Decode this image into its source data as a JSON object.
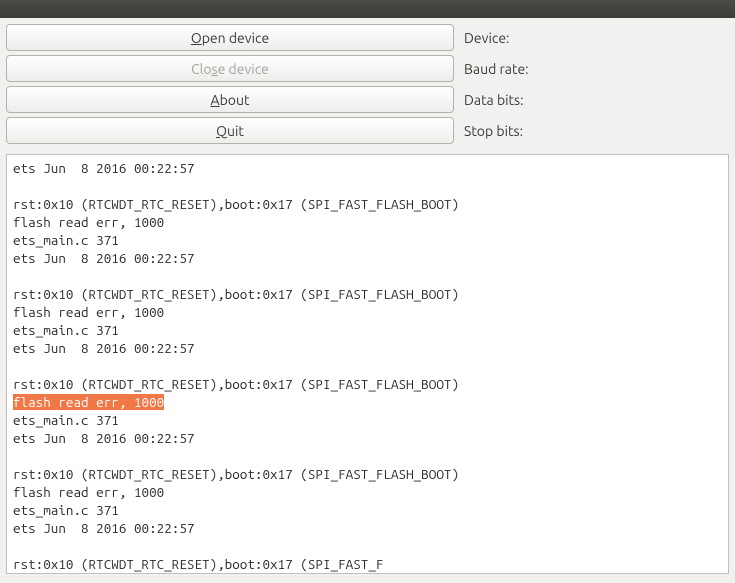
{
  "titlebar": {},
  "buttons": {
    "open_pre": "",
    "open_m": "O",
    "open_post": "pen device",
    "close_pre": "Clo",
    "close_m": "s",
    "close_post": "e device",
    "about_pre": "",
    "about_m": "A",
    "about_post": "bout",
    "quit_pre": "",
    "quit_m": "Q",
    "quit_post": "uit"
  },
  "labels": {
    "device": "Device:",
    "baud": "Baud rate:",
    "databits": "Data bits:",
    "stopbits": "Stop bits:"
  },
  "terminal": {
    "l0": "ets Jun  8 2016 00:22:57",
    "l1": "",
    "l2": "rst:0x10 (RTCWDT_RTC_RESET),boot:0x17 (SPI_FAST_FLASH_BOOT)",
    "l3": "flash read err, 1000",
    "l4": "ets_main.c 371 ",
    "l5": "ets Jun  8 2016 00:22:57",
    "l6": "",
    "l7": "rst:0x10 (RTCWDT_RTC_RESET),boot:0x17 (SPI_FAST_FLASH_BOOT)",
    "l8": "flash read err, 1000",
    "l9": "ets_main.c 371 ",
    "l10": "ets Jun  8 2016 00:22:57",
    "l11": "",
    "l12": "rst:0x10 (RTCWDT_RTC_RESET),boot:0x17 (SPI_FAST_FLASH_BOOT)",
    "l13": "flash read err, 1000",
    "l14": "ets_main.c 371 ",
    "l15": "ets Jun  8 2016 00:22:57",
    "l16": "",
    "l17": "rst:0x10 (RTCWDT_RTC_RESET),boot:0x17 (SPI_FAST_FLASH_BOOT)",
    "l18": "flash read err, 1000",
    "l19": "ets_main.c 371 ",
    "l20": "ets Jun  8 2016 00:22:57",
    "l21": "",
    "l22": "rst:0x10 (RTCWDT_RTC_RESET),boot:0x17 (SPI_FAST_F"
  }
}
